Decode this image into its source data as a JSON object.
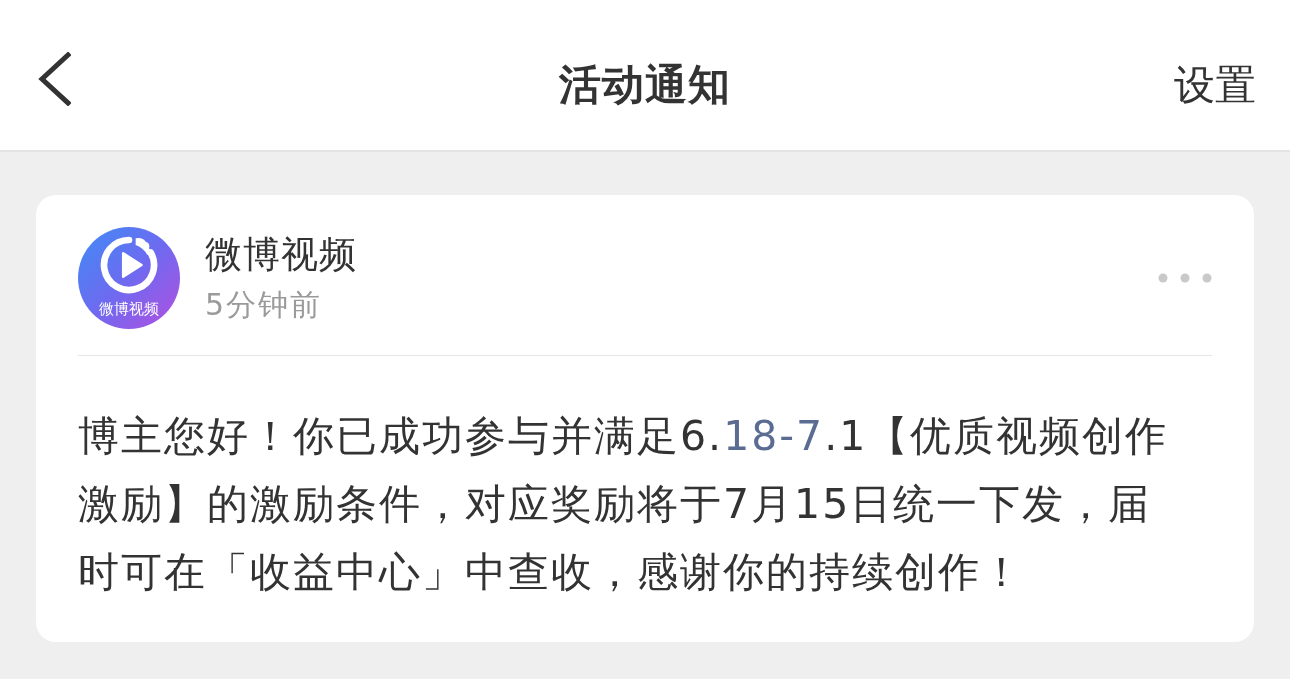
{
  "header": {
    "title": "活动通知",
    "action": "设置"
  },
  "notification": {
    "avatar_label": "微博视频",
    "sender": "微博视频",
    "time": "5分钟前",
    "body": [
      {
        "kind": "text",
        "text": "博主您好！你已成功参与并满足6."
      },
      {
        "kind": "link",
        "text": "18-7"
      },
      {
        "kind": "text",
        "text": ".1【优质视频创作激励】的激励条件，对应奖励将于7月15日统一下发，届时可在「收益中心」中查收，感谢你的持续创作！"
      }
    ]
  }
}
